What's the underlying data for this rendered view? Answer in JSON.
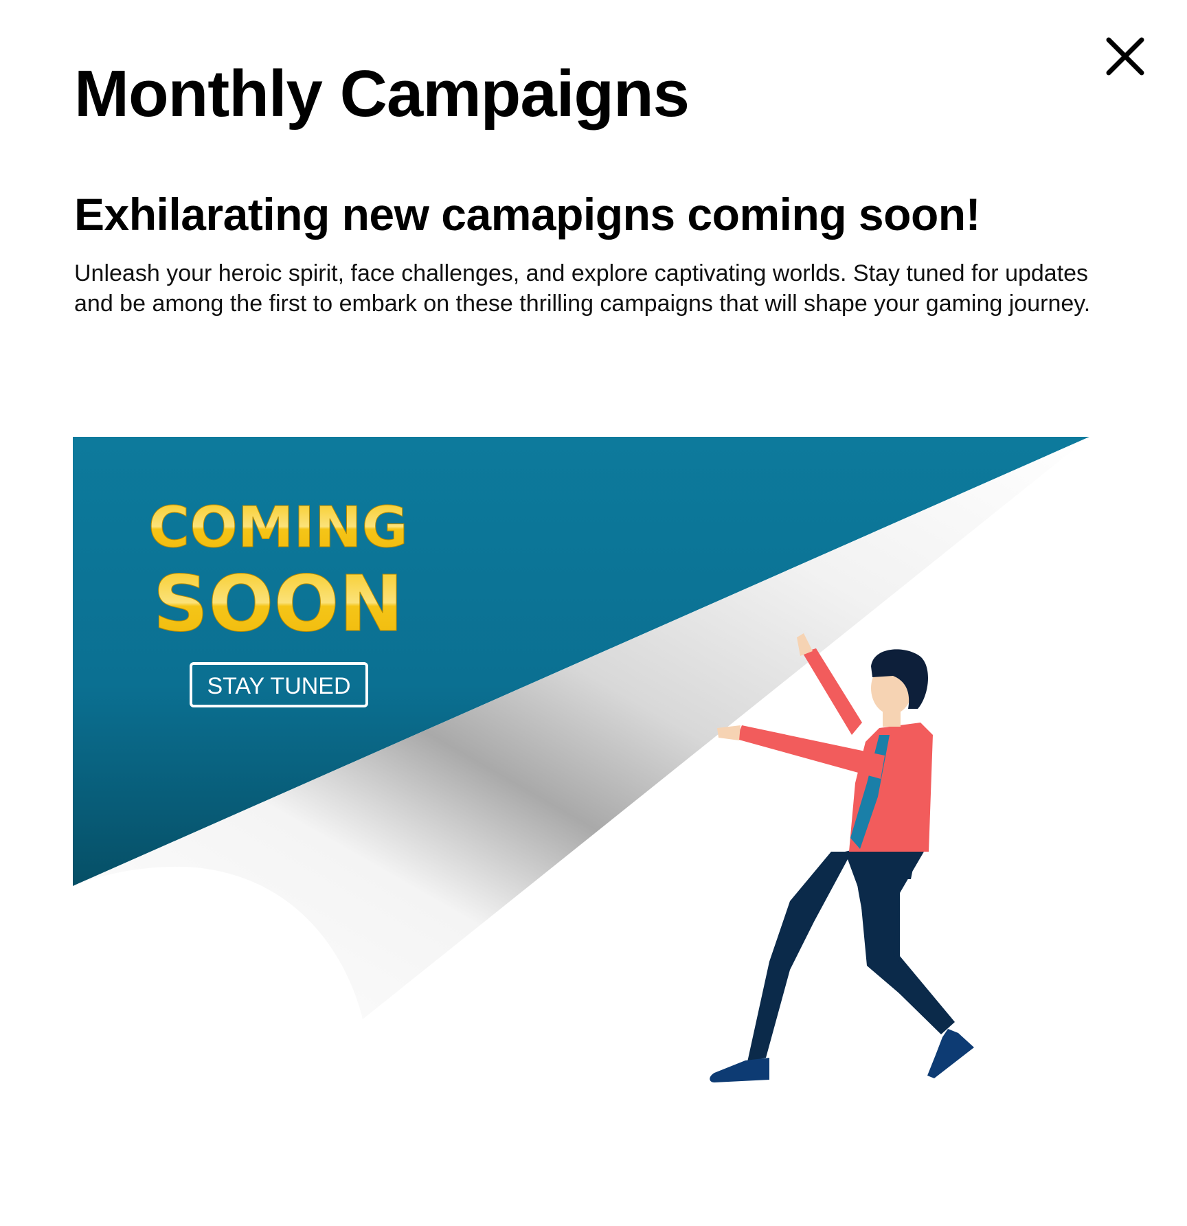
{
  "modal": {
    "title": "Monthly Campaigns",
    "close_icon": "close-icon",
    "headline": "Exhilarating new camapigns coming soon!",
    "description": "Unleash your heroic spirit, face challenges, and explore captivating worlds. Stay tuned for updates and be among the first to embark on these thrilling campaigns that will shape your gaming journey."
  },
  "banner": {
    "coming": "COMING",
    "soon": "SOON",
    "stay_tuned": "STAY TUNED"
  },
  "colors": {
    "banner_teal": "#0d7a9c",
    "banner_dark": "#064f66",
    "gold": "#f5c518",
    "shirt": "#f25c5c",
    "pants": "#0b2a4a",
    "tie": "#1a7fa8",
    "skin": "#f6d3b3",
    "hair": "#0d1f3a"
  }
}
